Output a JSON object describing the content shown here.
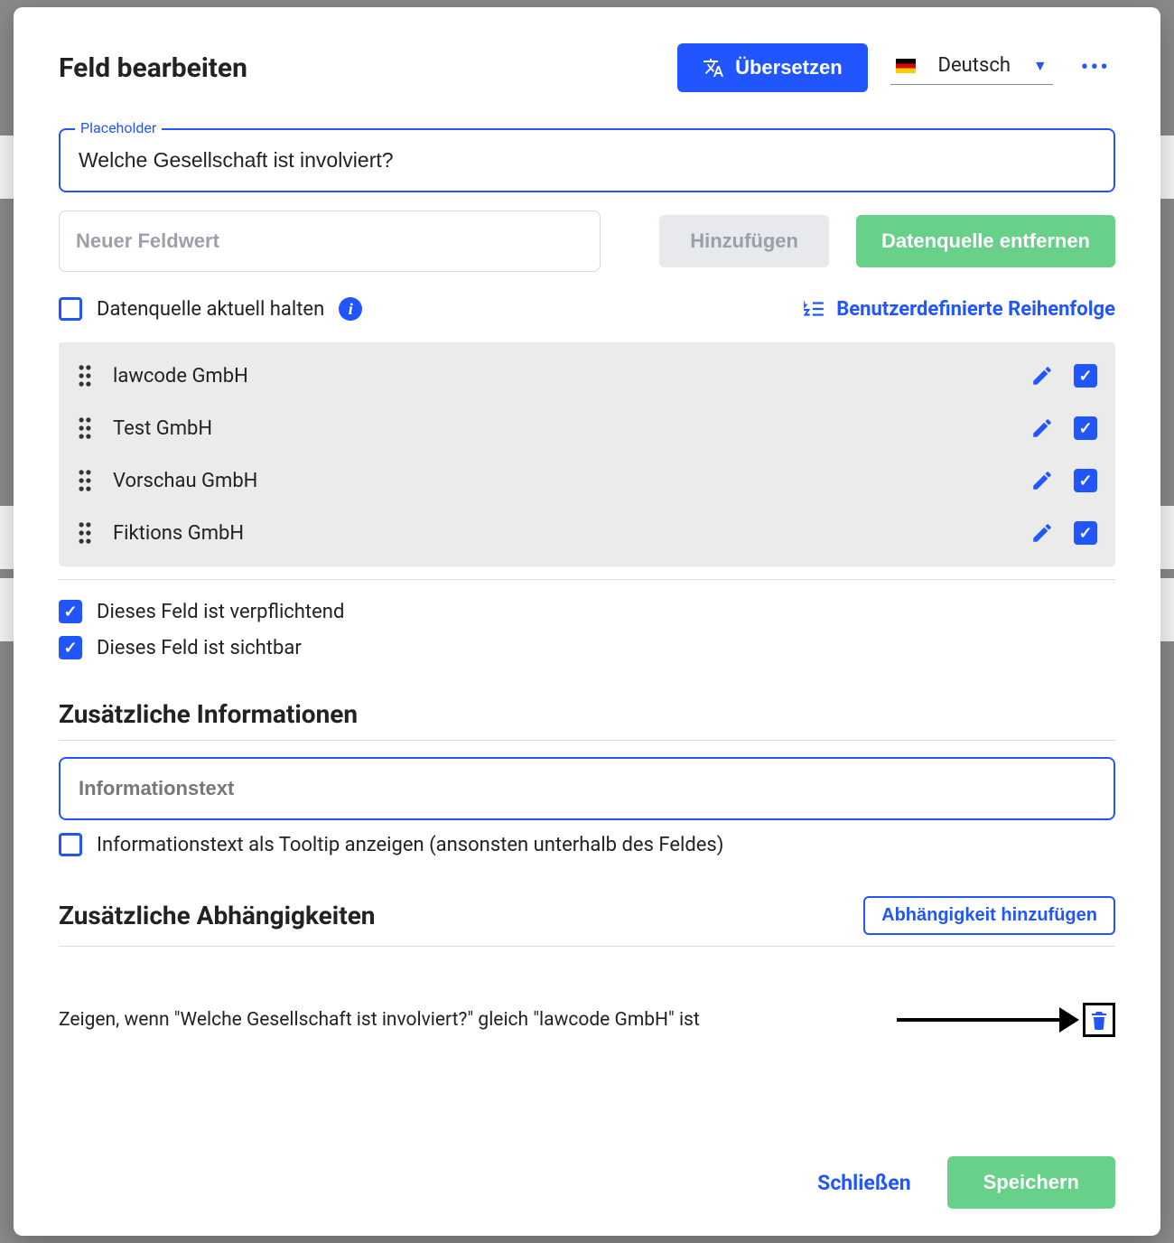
{
  "header": {
    "title": "Feld bearbeiten",
    "translate": "Übersetzen",
    "language": "Deutsch"
  },
  "placeholder": {
    "label": "Placeholder",
    "value": "Welche Gesellschaft ist involviert?"
  },
  "newValue": {
    "placeholder": "Neuer Feldwert",
    "add": "Hinzufügen",
    "removeSource": "Datenquelle entfernen"
  },
  "flags": {
    "keepSourceCurrent": "Datenquelle aktuell halten",
    "customOrder": "Benutzerdefinierte Reihenfolge"
  },
  "items": [
    {
      "name": "lawcode GmbH",
      "checked": true
    },
    {
      "name": "Test GmbH",
      "checked": true
    },
    {
      "name": "Vorschau GmbH",
      "checked": true
    },
    {
      "name": "Fiktions GmbH",
      "checked": true
    }
  ],
  "fieldOptions": {
    "required": "Dieses Feld ist verpflichtend",
    "visible": "Dieses Feld ist sichtbar"
  },
  "additionalInfo": {
    "title": "Zusätzliche Informationen",
    "placeholder": "Informationstext",
    "tooltip": "Informationstext als Tooltip anzeigen (ansonsten unterhalb des Feldes)"
  },
  "dependencies": {
    "title": "Zusätzliche Abhängigkeiten",
    "add": "Abhängigkeit hinzufügen",
    "rule": "Zeigen, wenn \"Welche Gesellschaft ist involviert?\" gleich \"lawcode GmbH\" ist"
  },
  "footer": {
    "close": "Schließen",
    "save": "Speichern"
  }
}
